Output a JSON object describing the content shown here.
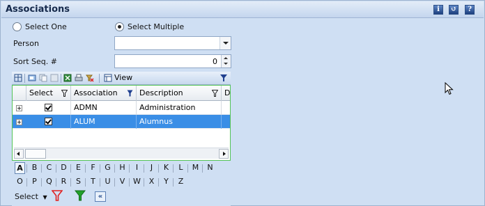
{
  "panel": {
    "title": "Associations",
    "header_icons": [
      {
        "name": "info-icon",
        "glyph": "i"
      },
      {
        "name": "refresh-icon",
        "glyph": "↺"
      },
      {
        "name": "help-icon",
        "glyph": "?"
      }
    ]
  },
  "mode": {
    "select_one_label": "Select One",
    "select_multiple_label": "Select Multiple",
    "selected": "multiple"
  },
  "form": {
    "person_label": "Person",
    "person_value": "",
    "sort_seq_label": "Sort Seq. #",
    "sort_seq_value": "0"
  },
  "toolbar": {
    "view_label": "View",
    "icons": [
      "columns-icon",
      "group-icon",
      "copy-icon",
      "excel-icon",
      "print-icon",
      "clear-filter-icon",
      "view-icon",
      "filter-icon"
    ]
  },
  "grid": {
    "columns": [
      {
        "label": "Select",
        "filter": "outline"
      },
      {
        "label": "Association",
        "filter": "active"
      },
      {
        "label": "Description",
        "filter": "outline"
      },
      {
        "label": "De",
        "filter": "none"
      }
    ],
    "rows": [
      {
        "select": true,
        "association": "ADMN",
        "description": "Administration",
        "selected": false
      },
      {
        "select": true,
        "association": "ALUM",
        "description": "Alumnus",
        "selected": true
      }
    ]
  },
  "alphabet": {
    "row1": [
      "A",
      "B",
      "C",
      "D",
      "E",
      "F",
      "G",
      "H",
      "I",
      "J",
      "K",
      "L",
      "M",
      "N"
    ],
    "row2": [
      "O",
      "P",
      "Q",
      "R",
      "S",
      "T",
      "U",
      "V",
      "W",
      "X",
      "Y",
      "Z"
    ],
    "active_letter": "A",
    "select_label": "Select"
  },
  "colors": {
    "panel_bg": "#cfdff3",
    "header_title": "#15294b",
    "selected_row": "#3a8ee6",
    "grid_border": "#53c356",
    "filter_active": "#1f3f8f",
    "funnel_red": "#e02020",
    "funnel_green": "#22a02a"
  }
}
